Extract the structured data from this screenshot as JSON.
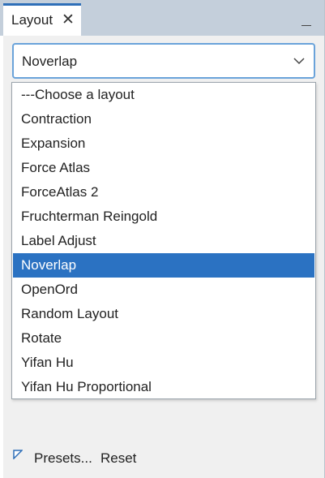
{
  "tab": {
    "title": "Layout",
    "close_glyph": "✕"
  },
  "layout_select": {
    "selected": "Noverlap",
    "arrow_icon": "chevron-down-icon",
    "options": [
      "---Choose a layout",
      "Contraction",
      "Expansion",
      "Force Atlas",
      "ForceAtlas 2",
      "Fruchterman Reingold",
      "Label Adjust",
      "Noverlap",
      "OpenOrd",
      "Random Layout",
      "Rotate",
      "Yifan Hu",
      "Yifan Hu Proportional"
    ],
    "selected_index": 7
  },
  "footer": {
    "presets_label": "Presets...",
    "reset_label": "Reset"
  },
  "colors": {
    "tab_bar": "#c4cfdb",
    "accent": "#2f6fb8",
    "selection": "#2b72c2",
    "combo_border": "#6aa3da",
    "panel_bg": "#f0f0f0"
  }
}
